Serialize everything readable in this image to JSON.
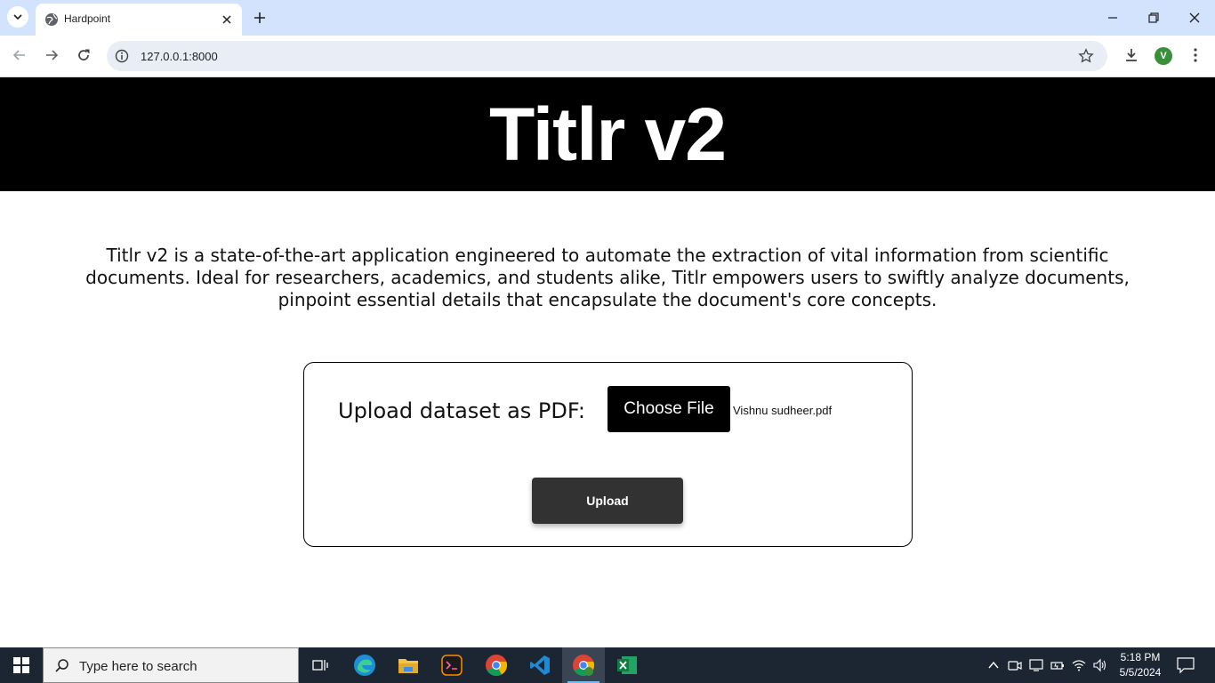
{
  "browser": {
    "tab_title": "Hardpoint",
    "url": "127.0.0.1:8000",
    "profile_initial": "V"
  },
  "page": {
    "title": "Titlr v2",
    "description": "Titlr v2 is a state-of-the-art application engineered to automate the extraction of vital information from scientific documents. Ideal for researchers, academics, and students alike, Titlr empowers users to swiftly analyze documents, pinpoint essential details that encapsulate the document's core concepts.",
    "upload_label": "Upload dataset as PDF:",
    "choose_file_label": "Choose File",
    "selected_file": "Vishnu sudheer.pdf",
    "upload_button": "Upload"
  },
  "taskbar": {
    "search_placeholder": "Type here to search",
    "time": "5:18 PM",
    "date": "5/5/2024",
    "apps": [
      "task-view",
      "edge",
      "file-explorer",
      "terminal",
      "chrome",
      "vscode",
      "chrome-profile",
      "excel"
    ]
  },
  "colors": {
    "tabbar_bg": "#d3e3fd",
    "hero_bg": "#000000",
    "upload_bg": "#323232"
  }
}
